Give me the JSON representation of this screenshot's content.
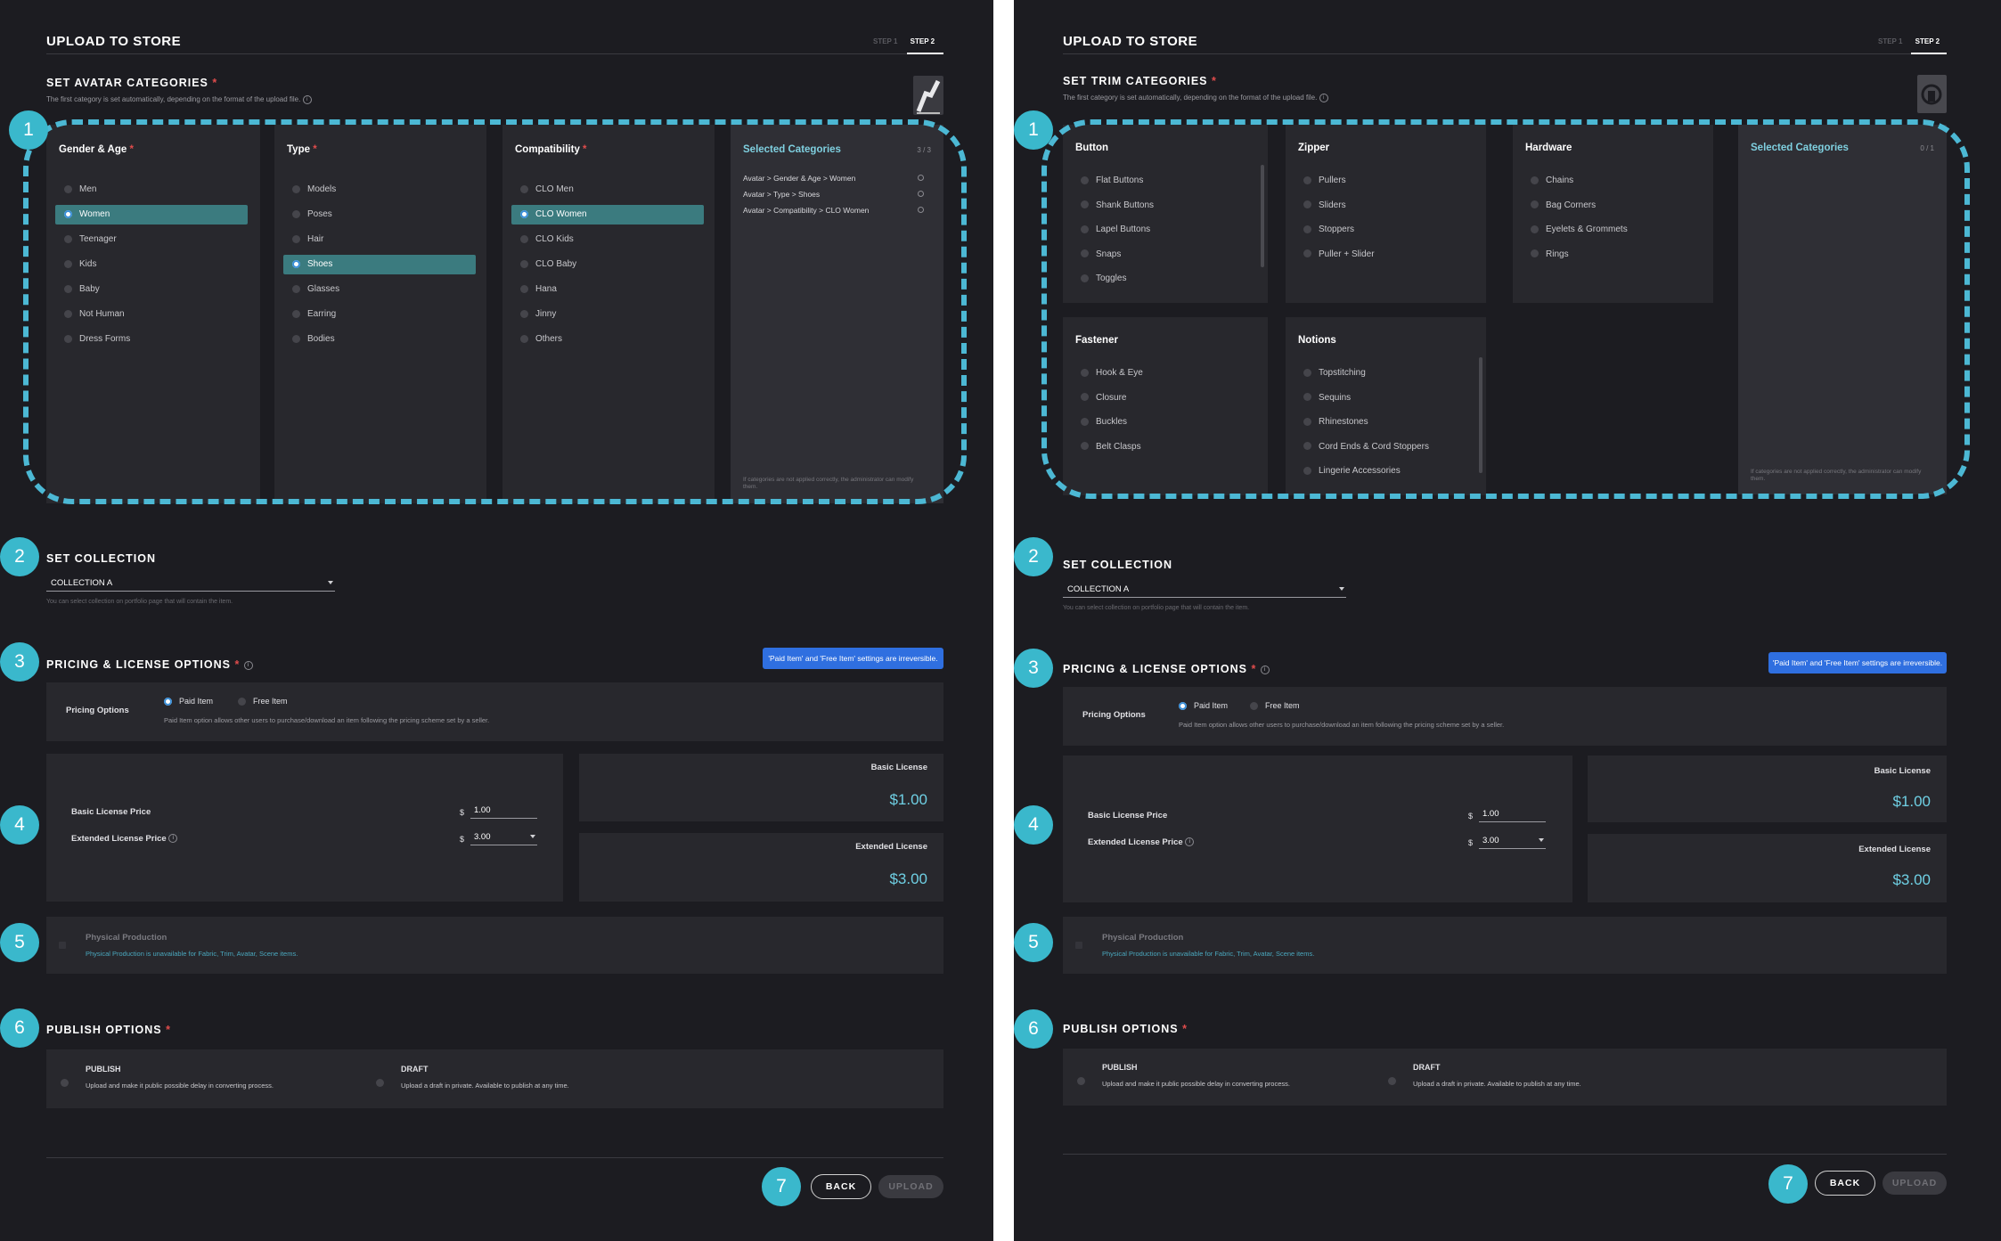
{
  "left": {
    "title": "UPLOAD TO STORE",
    "step1": "STEP 1",
    "step2": "STEP 2",
    "categories_title": "SET AVATAR CATEGORIES",
    "categories_help": "The first category is set automatically, depending on the format of the upload file.",
    "columns": [
      {
        "title": "Gender & Age",
        "required": true,
        "items": [
          "Men",
          "Women",
          "Teenager",
          "Kids",
          "Baby",
          "Not Human",
          "Dress Forms"
        ],
        "selected": 1
      },
      {
        "title": "Type",
        "required": true,
        "items": [
          "Models",
          "Poses",
          "Hair",
          "Shoes",
          "Glasses",
          "Earring",
          "Bodies"
        ],
        "selected": 3
      },
      {
        "title": "Compatibility",
        "required": true,
        "items": [
          "CLO Men",
          "CLO Women",
          "CLO Kids",
          "CLO Baby",
          "Hana",
          "Jinny",
          "Others"
        ],
        "selected": 1
      }
    ],
    "selected_title": "Selected Categories",
    "selected_count": "3 / 3",
    "selected_rows": [
      "Avatar > Gender & Age > Women",
      "Avatar > Type > Shoes",
      "Avatar > Compatibility > CLO Women"
    ],
    "selected_note": "If categories are not applied correctly, the administrator can modify them."
  },
  "right": {
    "title": "UPLOAD TO STORE",
    "step1": "STEP 1",
    "step2": "STEP 2",
    "categories_title": "SET TRIM CATEGORIES",
    "categories_help": "The first category is set automatically, depending on the format of the upload file.",
    "groups": [
      {
        "title": "Button",
        "items": [
          "Flat Buttons",
          "Shank Buttons",
          "Lapel Buttons",
          "Snaps",
          "Toggles"
        ]
      },
      {
        "title": "Zipper",
        "items": [
          "Pullers",
          "Sliders",
          "Stoppers",
          "Puller + Slider"
        ]
      },
      {
        "title": "Hardware",
        "items": [
          "Chains",
          "Bag Corners",
          "Eyelets & Grommets",
          "Rings"
        ]
      },
      {
        "title": "Fastener",
        "items": [
          "Hook & Eye",
          "Closure",
          "Buckles",
          "Belt Clasps"
        ]
      },
      {
        "title": "Notions",
        "items": [
          "Topstitching",
          "Sequins",
          "Rhinestones",
          "Cord Ends & Cord Stoppers",
          "Lingerie Accessories"
        ]
      }
    ],
    "selected_title": "Selected Categories",
    "selected_count": "0 / 1",
    "selected_note": "If categories are not applied correctly, the administrator can modify them."
  },
  "common": {
    "badges": [
      "1",
      "2",
      "3",
      "4",
      "5",
      "6",
      "7"
    ],
    "collection_title": "SET COLLECTION",
    "collection_value": "COLLECTION A",
    "collection_help": "You can select collection on portfolio page that will contain the item.",
    "pricing_title": "PRICING & LICENSE OPTIONS",
    "pricing_tip": "'Paid Item' and 'Free Item' settings are irreversible.",
    "pricing_options_label": "Pricing Options",
    "paid_item": "Paid Item",
    "free_item": "Free Item",
    "paid_desc": "Paid Item option allows other users to purchase/download an item following the pricing scheme set by a seller.",
    "basic_price_label": "Basic License Price",
    "extended_price_label": "Extended License Price",
    "currency": "$",
    "basic_price_value": "1.00",
    "extended_price_value": "3.00",
    "basic_license": "Basic License",
    "basic_license_price": "$1.00",
    "extended_license": "Extended License",
    "extended_license_price": "$3.00",
    "physical_title": "Physical Production",
    "physical_desc": "Physical Production is unavailable for Fabric, Trim, Avatar, Scene items.",
    "publish_title": "PUBLISH OPTIONS",
    "publish_label": "PUBLISH",
    "publish_desc": "Upload and make it public possible delay in converting process.",
    "draft_label": "DRAFT",
    "draft_desc": "Upload a draft in private. Available to publish at any time.",
    "back_label": "BACK",
    "upload_label": "UPLOAD"
  },
  "colors": {
    "background": "#1c1c21",
    "box": "#28282d",
    "accent": "#3ab8cc",
    "selection": "#3b7b7f",
    "tooltip": "#2f6fe0",
    "required": "#e04c4c"
  }
}
